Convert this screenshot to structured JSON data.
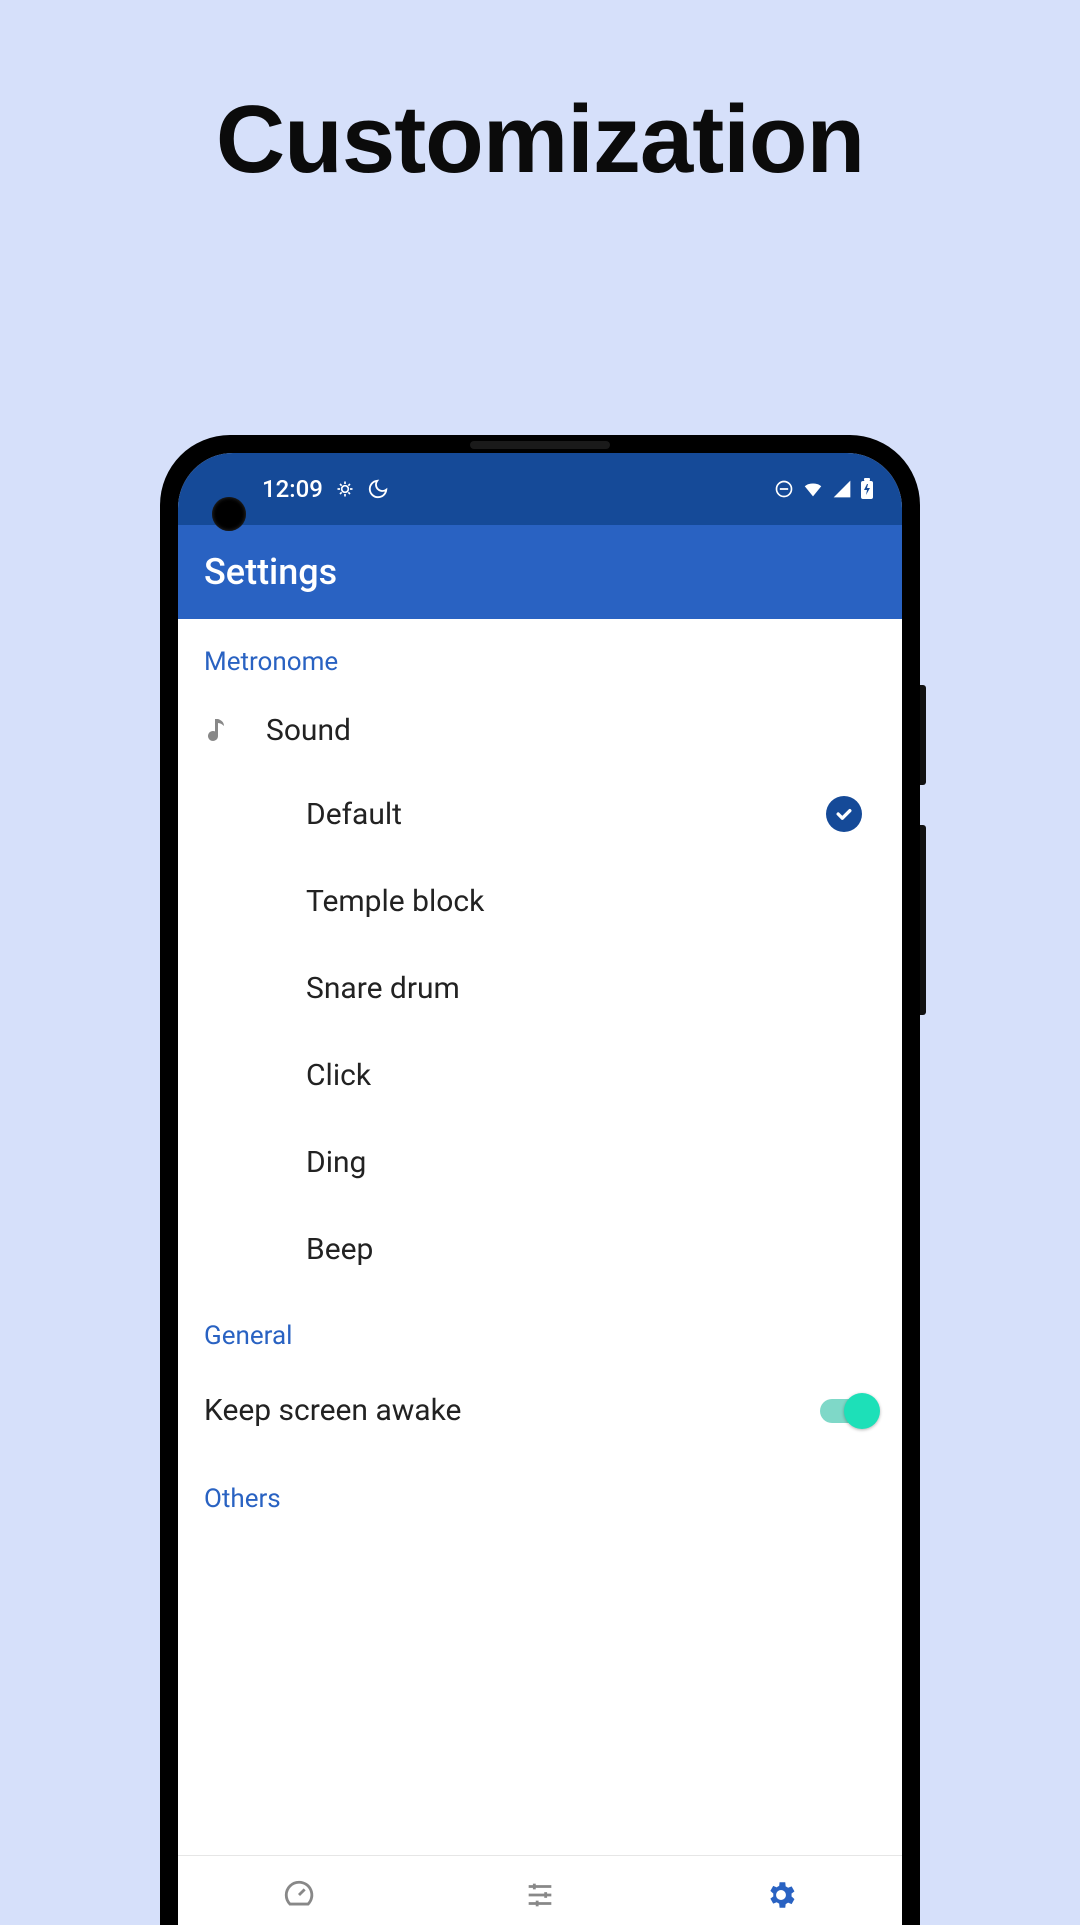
{
  "promo_title": "Customization",
  "status_bar": {
    "time": "12:09"
  },
  "app_bar": {
    "title": "Settings"
  },
  "sections": {
    "metronome": {
      "header": "Metronome",
      "sound_label": "Sound",
      "options": [
        {
          "label": "Default",
          "selected": true
        },
        {
          "label": "Temple block",
          "selected": false
        },
        {
          "label": "Snare drum",
          "selected": false
        },
        {
          "label": "Click",
          "selected": false
        },
        {
          "label": "Ding",
          "selected": false
        },
        {
          "label": "Beep",
          "selected": false
        }
      ]
    },
    "general": {
      "header": "General",
      "keep_awake_label": "Keep screen awake",
      "keep_awake_on": true
    },
    "others": {
      "header": "Others"
    }
  },
  "colors": {
    "background": "#d6e0fa",
    "status_bar": "#154a98",
    "app_bar": "#2962c2",
    "accent": "#2962c2",
    "switch_on": "#1de0b8"
  }
}
